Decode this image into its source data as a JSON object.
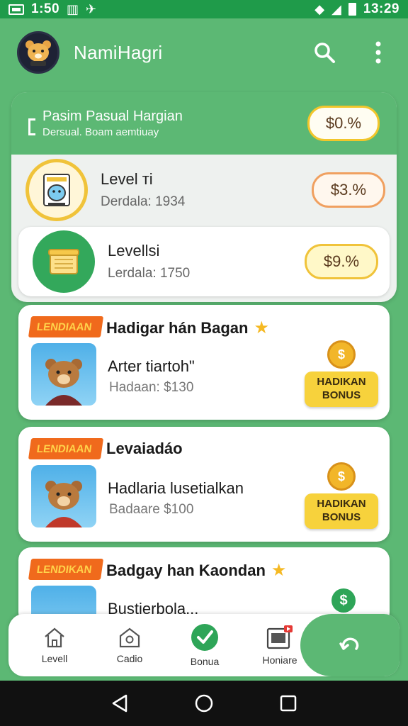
{
  "status_bar": {
    "time_left": "1:50",
    "time_right": "13:29"
  },
  "app_bar": {
    "title": "NamiHagri"
  },
  "summary": {
    "title": "Pasim Pasual Hargian",
    "subtitle": "Dersual. Boam aemtiuay",
    "value": "$0.%"
  },
  "levels": [
    {
      "name": "Level ті",
      "detail": "Derdala: 1934",
      "value": "$3.%"
    },
    {
      "name": "Levellsi",
      "detail": "Lerdala: 1750",
      "value": "$9.%"
    }
  ],
  "offers": [
    {
      "tag": "LENDIAAN",
      "title": "Hadigar hán Bagan",
      "subtitle": "Arter tiartoh\"",
      "price": "Hadaan: $130",
      "button": [
        "HADIKAN",
        "BONUS"
      ]
    },
    {
      "tag": "LENDIAAN",
      "title": "Levaiadáo",
      "subtitle": "Hadlaria lusetialkan",
      "price": "Badaare $100",
      "button": [
        "HADIKAN",
        "BONUS"
      ]
    },
    {
      "tag": "LENDIKAN",
      "title": "Badgay han Kaondan",
      "subtitle": "Bustierbola..."
    }
  ],
  "bottom_nav": [
    {
      "label": "Levell",
      "icon": "home-icon"
    },
    {
      "label": "Cadio",
      "icon": "camera-house-icon"
    },
    {
      "label": "Bonua",
      "icon": "check-circle-icon"
    },
    {
      "label": "Honiare",
      "icon": "video-card-icon"
    }
  ],
  "colors": {
    "primary_green": "#5cb874",
    "dark_green": "#1f9b4a",
    "accent_yellow": "#f7d23c",
    "ribbon_orange": "#f06a1c"
  }
}
